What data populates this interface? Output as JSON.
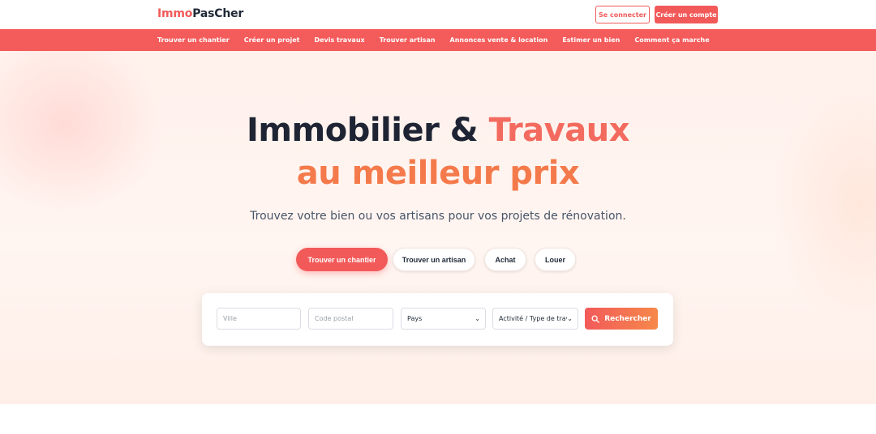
{
  "header": {
    "logo_part1": "Immo",
    "logo_part2": "PasCher",
    "login_label": "Se connecter",
    "signup_label": "Créer un compte"
  },
  "nav": {
    "items": [
      "Trouver un chantier",
      "Créer un projet",
      "Devis travaux",
      "Trouver artisan",
      "Annonces vente & location",
      "Estimer un bien",
      "Comment ça marche"
    ]
  },
  "hero": {
    "title_part1": "Immobilier & ",
    "title_accent": "Travaux",
    "title_line2": "au meilleur prix",
    "subtitle": "Trouvez votre bien ou vos artisans pour vos projets de rénovation."
  },
  "tabs": [
    {
      "label": "Trouver un chantier",
      "active": true
    },
    {
      "label": "Trouver un artisan",
      "active": false
    },
    {
      "label": "Achat",
      "active": false
    },
    {
      "label": "Louer",
      "active": false
    }
  ],
  "search": {
    "city_placeholder": "Ville",
    "postal_placeholder": "Code postal",
    "country_value": "Pays",
    "activity_value": "Activité / Type de travaux",
    "search_label": "Rechercher"
  },
  "colors": {
    "brand": "#f25a5a",
    "brand_orange": "#f6884a",
    "dark": "#1e2433"
  }
}
